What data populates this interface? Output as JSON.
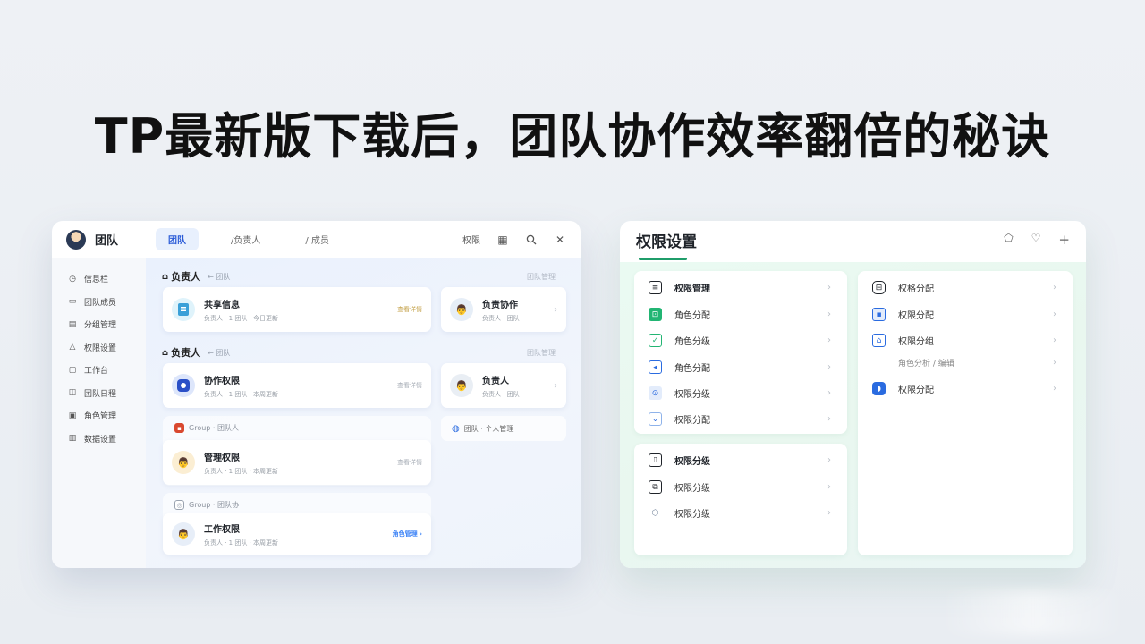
{
  "headline": "TP最新版下载后，团队协作效率翻倍的秘诀",
  "team_window": {
    "title": "团队",
    "tabs": [
      {
        "label": "团队",
        "active": true
      },
      {
        "label": "/负责人",
        "active": false
      },
      {
        "label": "/ 成员",
        "active": false
      }
    ],
    "actions": {
      "text_action": "权限",
      "calendar_icon": "calendar-icon",
      "search_icon": "search-icon",
      "close_icon": "close-icon"
    },
    "sidebar": [
      {
        "icon": "clock-icon",
        "label": "信息栏"
      },
      {
        "icon": "chat-icon",
        "label": "团队成员"
      },
      {
        "icon": "folder-icon",
        "label": "分组管理"
      },
      {
        "icon": "warning-icon",
        "label": "权限设置"
      },
      {
        "icon": "doc-icon",
        "label": "工作台"
      },
      {
        "icon": "calendar-icon",
        "label": "团队日程"
      },
      {
        "icon": "grid-icon",
        "label": "角色管理"
      },
      {
        "icon": "list-icon",
        "label": "数据设置"
      }
    ],
    "section1": {
      "title": "负责人",
      "subtitle": "← 团队",
      "more": "团队管理"
    },
    "section2": {
      "title": "负责人",
      "subtitle": "← 团队",
      "more": "团队管理"
    },
    "cards": [
      {
        "name": "共享信息",
        "meta": "负责人 · 1 团队 · 今日更新",
        "right": "查看详情"
      },
      {
        "name": "负责协作",
        "meta": "负责人 · 团队",
        "right": ""
      },
      {
        "name": "协作权限",
        "meta": "负责人 · 1 团队 · 本周更新",
        "right": "查看详情"
      },
      {
        "name": "负责人",
        "meta": "负责人 · 团队",
        "right": ""
      },
      {
        "name": "管理权限",
        "meta": "负责人 · 1 团队 · 本周更新",
        "right": "查看详情"
      },
      {
        "name": "工作权限",
        "meta": "负责人 · 1 团队 · 本周更新",
        "right": "角色管理 ›"
      }
    ],
    "group1_label": "Group · 团队人",
    "group2_label": "Group · 团队协",
    "pill_label": "团队 · 个人管理"
  },
  "perm_window": {
    "title": "权限设置",
    "header_icons": [
      "shield-icon",
      "heart-icon",
      "plus-icon"
    ],
    "left_panel_top": [
      {
        "icon": "id-card-icon",
        "label": "权限管理",
        "bold": true,
        "color": "#1f2329"
      },
      {
        "icon": "users-icon",
        "label": "角色分配",
        "bold": false,
        "color": "#22b573"
      },
      {
        "icon": "check-icon",
        "label": "角色分级",
        "bold": false,
        "color": "#22b573"
      },
      {
        "icon": "play-icon",
        "label": "角色分配",
        "bold": false,
        "color": "#2a6be0"
      },
      {
        "icon": "key-icon",
        "label": "权限分级",
        "bold": false,
        "color": "#2a6be0"
      },
      {
        "icon": "chevron-down-icon",
        "label": "权限分配",
        "bold": false,
        "color": "#2a6be0"
      }
    ],
    "left_panel_bottom": [
      {
        "icon": "clipboard-icon",
        "label": "权限分级",
        "bold": true,
        "color": "#1f2329"
      },
      {
        "icon": "layers-icon",
        "label": "权限分级",
        "bold": false,
        "color": "#1f2329"
      },
      {
        "icon": "shield-icon",
        "label": "权限分级",
        "bold": false,
        "color": "#7a8aa0"
      }
    ],
    "right_panel": [
      {
        "icon": "lock-icon",
        "label": "权格分配",
        "bold": false,
        "color": "#1f2329"
      },
      {
        "icon": "image-icon",
        "label": "权限分配",
        "bold": false,
        "color": "#2a6be0"
      },
      {
        "icon": "picture-icon",
        "label": "权限分组",
        "bold": false,
        "color": "#2a6be0"
      },
      {
        "icon": "",
        "label": "角色分析 / 编辑",
        "bold": false,
        "color": "#888888"
      },
      {
        "icon": "tag-icon",
        "label": "权限分配",
        "bold": false,
        "color": "#2a6be0"
      }
    ]
  }
}
